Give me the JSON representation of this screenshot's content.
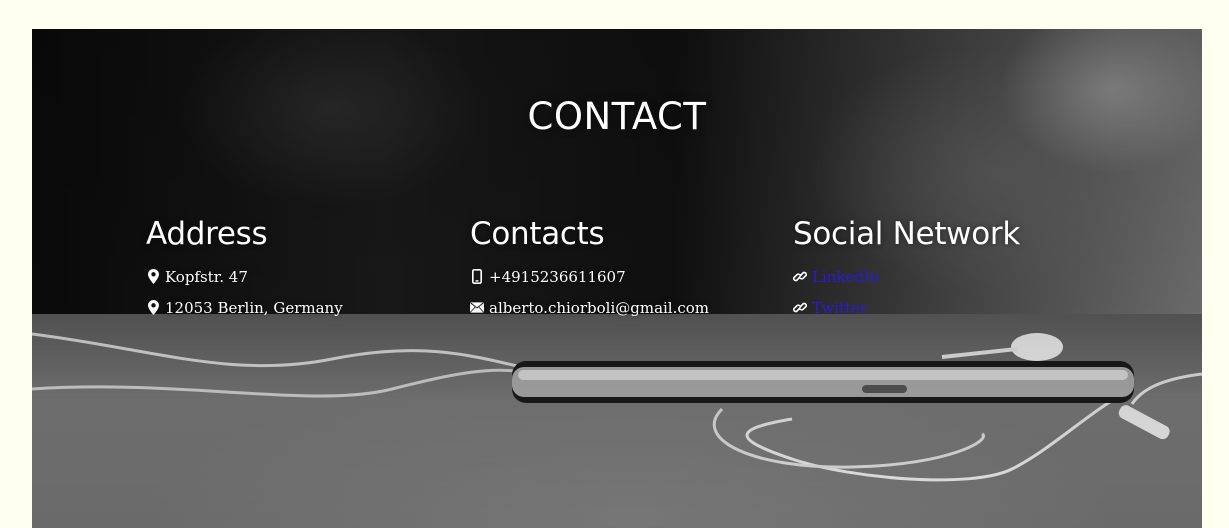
{
  "section": {
    "title": "CONTACT"
  },
  "address": {
    "heading": "Address",
    "lines": [
      "Kopfstr. 47",
      "12053 Berlin, Germany"
    ],
    "icon": "map-marker-icon"
  },
  "contacts": {
    "heading": "Contacts",
    "phone": "+4915236611607",
    "email": "alberto.chiorboli@gmail.com",
    "phone_icon": "mobile-phone-icon",
    "email_icon": "envelope-icon"
  },
  "social": {
    "heading": "Social Network",
    "links": [
      "LinkedIn",
      "Twitter"
    ],
    "icon": "link-icon",
    "link_color": "#2a1bd6"
  },
  "colors": {
    "page_background": "#fffff0",
    "text": "#ffffff"
  }
}
